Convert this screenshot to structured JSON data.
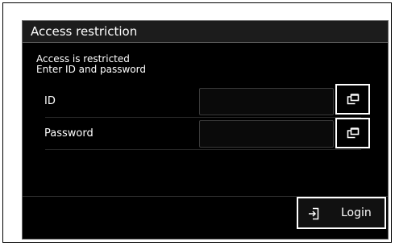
{
  "dialog": {
    "title": "Access restriction",
    "message_line1": "Access is restricted",
    "message_line2": "Enter ID and password"
  },
  "fields": {
    "id_label": "ID",
    "id_value": "",
    "password_label": "Password",
    "password_value": "",
    "input_icon": "edit-window-icon"
  },
  "actions": {
    "login_label": "Login",
    "login_icon": "login-icon"
  }
}
